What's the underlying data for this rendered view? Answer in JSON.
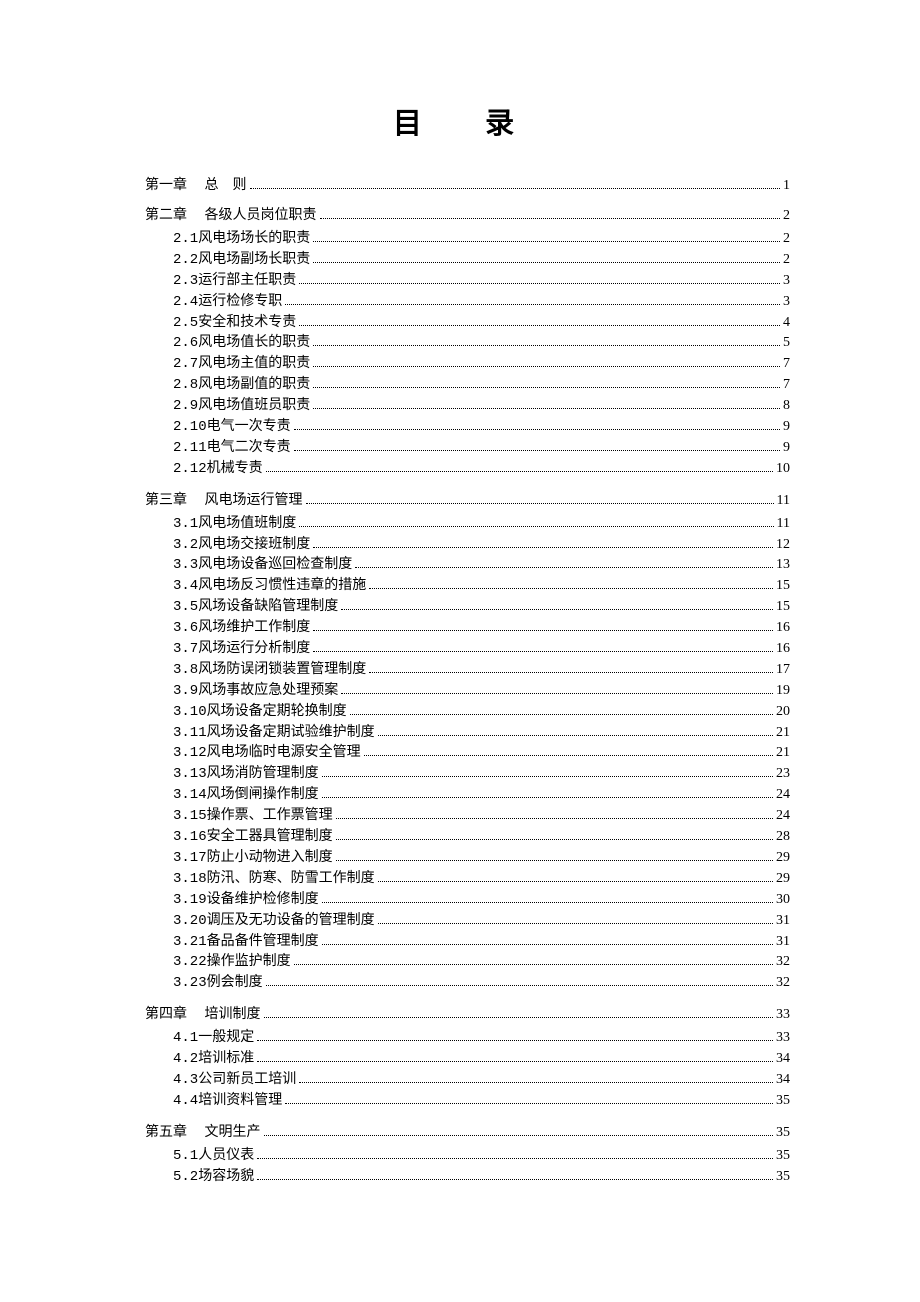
{
  "title": "目 录",
  "entries": [
    {
      "type": "chapter",
      "label": "第一章　 总　则",
      "page": "1"
    },
    {
      "type": "chapter",
      "label": "第二章　 各级人员岗位职责",
      "page": "2"
    },
    {
      "type": "sub",
      "num": "2.1",
      "text": "风电场场长的职责",
      "page": "2"
    },
    {
      "type": "sub",
      "num": "2.2",
      "text": "风电场副场长职责",
      "page": "2"
    },
    {
      "type": "sub",
      "num": "2.3",
      "text": "运行部主任职责",
      "page": "3"
    },
    {
      "type": "sub",
      "num": "2.4",
      "text": "运行检修专职",
      "page": "3"
    },
    {
      "type": "sub",
      "num": "2.5",
      "text": "安全和技术专责",
      "page": "4"
    },
    {
      "type": "sub",
      "num": "2.6",
      "text": "风电场值长的职责",
      "page": "5"
    },
    {
      "type": "sub",
      "num": "2.7",
      "text": "风电场主值的职责",
      "page": "7"
    },
    {
      "type": "sub",
      "num": "2.8",
      "text": "风电场副值的职责",
      "page": "7"
    },
    {
      "type": "sub",
      "num": "2.9",
      "text": "风电场值班员职责",
      "page": "8"
    },
    {
      "type": "sub",
      "num": "2.10",
      "text": "电气一次专责",
      "page": "9"
    },
    {
      "type": "sub",
      "num": "2.11",
      "text": "电气二次专责",
      "page": "9"
    },
    {
      "type": "sub",
      "num": "2.12",
      "text": "机械专责",
      "page": "10"
    },
    {
      "type": "chapter",
      "label": "第三章　 风电场运行管理",
      "page": "11"
    },
    {
      "type": "sub",
      "num": "3.1",
      "text": "风电场值班制度",
      "page": "11"
    },
    {
      "type": "sub",
      "num": "3.2",
      "text": "风电场交接班制度",
      "page": "12"
    },
    {
      "type": "sub",
      "num": "3.3",
      "text": "风电场设备巡回检查制度",
      "page": "13"
    },
    {
      "type": "sub",
      "num": "3.4",
      "text": "风电场反习惯性违章的措施",
      "page": "15"
    },
    {
      "type": "sub",
      "num": "3.5",
      "text": "风场设备缺陷管理制度",
      "page": "15"
    },
    {
      "type": "sub",
      "num": "3.6",
      "text": "风场维护工作制度",
      "page": "16"
    },
    {
      "type": "sub",
      "num": "3.7",
      "text": "风场运行分析制度",
      "page": "16"
    },
    {
      "type": "sub",
      "num": "3.8",
      "text": "风场防误闭锁装置管理制度",
      "page": "17"
    },
    {
      "type": "sub",
      "num": "3.9",
      "text": "风场事故应急处理预案",
      "page": "19"
    },
    {
      "type": "sub",
      "num": "3.10",
      "text": "风场设备定期轮换制度",
      "page": "20"
    },
    {
      "type": "sub",
      "num": "3.11",
      "text": "风场设备定期试验维护制度",
      "page": "21"
    },
    {
      "type": "sub",
      "num": "3.12",
      "text": "风电场临时电源安全管理",
      "page": "21"
    },
    {
      "type": "sub",
      "num": "3.13",
      "text": "风场消防管理制度",
      "page": "23"
    },
    {
      "type": "sub",
      "num": "3.14",
      "text": "风场倒闸操作制度",
      "page": "24"
    },
    {
      "type": "sub",
      "num": "3.15",
      "text": "操作票、工作票管理",
      "page": "24"
    },
    {
      "type": "sub",
      "num": "3.16",
      "text": "安全工器具管理制度",
      "page": "28"
    },
    {
      "type": "sub",
      "num": "3.17",
      "text": "防止小动物进入制度",
      "page": "29"
    },
    {
      "type": "sub",
      "num": "3.18",
      "text": "防汛、防寒、防雪工作制度",
      "page": "29"
    },
    {
      "type": "sub",
      "num": "3.19",
      "text": "设备维护检修制度",
      "page": "30"
    },
    {
      "type": "sub",
      "num": "3.20",
      "text": "调压及无功设备的管理制度",
      "page": "31"
    },
    {
      "type": "sub",
      "num": "3.21",
      "text": "备品备件管理制度",
      "page": "31"
    },
    {
      "type": "sub",
      "num": "3.22",
      "text": "操作监护制度",
      "page": "32"
    },
    {
      "type": "sub",
      "num": "3.23",
      "text": "例会制度",
      "page": "32"
    },
    {
      "type": "chapter",
      "label": "第四章　 培训制度",
      "page": "33"
    },
    {
      "type": "sub",
      "num": "4.1",
      "text": "一般规定",
      "page": "33"
    },
    {
      "type": "sub",
      "num": "4.2",
      "text": "培训标准",
      "page": "34"
    },
    {
      "type": "sub",
      "num": "4.3",
      "text": "公司新员工培训",
      "page": "34"
    },
    {
      "type": "sub",
      "num": "4.4",
      "text": "培训资料管理",
      "page": "35"
    },
    {
      "type": "chapter",
      "label": "第五章　 文明生产",
      "page": "35"
    },
    {
      "type": "sub",
      "num": "5.1",
      "text": "人员仪表",
      "page": "35"
    },
    {
      "type": "sub",
      "num": "5.2",
      "text": "场容场貌",
      "page": "35"
    }
  ]
}
